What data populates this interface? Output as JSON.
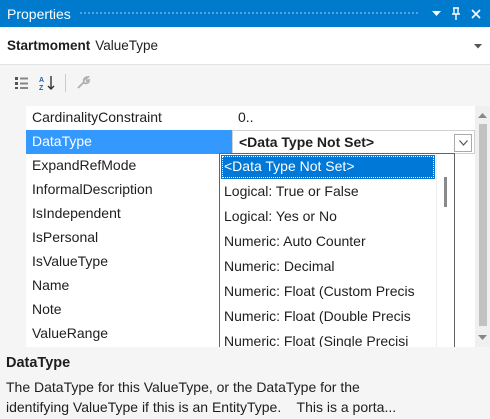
{
  "window": {
    "title": "Properties",
    "menu_icon": "chevron-down-icon",
    "pin_icon": "pin-icon",
    "close_icon": "close-icon",
    "accent": "#007acc"
  },
  "object_selector": {
    "name": "Startmoment",
    "type": "ValueType"
  },
  "toolbar": {
    "items": [
      "categorized-icon",
      "alphabetical-icon",
      "property-pages-icon"
    ]
  },
  "grid": {
    "rows": [
      {
        "name": "CardinalityConstraint",
        "value": "0.."
      },
      {
        "name": "DataType",
        "value": "<Data Type Not Set>",
        "selected": true
      },
      {
        "name": "ExpandRefMode",
        "value": ""
      },
      {
        "name": "InformalDescription",
        "value": ""
      },
      {
        "name": "IsIndependent",
        "value": ""
      },
      {
        "name": "IsPersonal",
        "value": ""
      },
      {
        "name": "IsValueType",
        "value": ""
      },
      {
        "name": "Name",
        "value": ""
      },
      {
        "name": "Note",
        "value": ""
      },
      {
        "name": "ValueRange",
        "value": ""
      }
    ],
    "selection_color": "#3399ff"
  },
  "dropdown": {
    "options": [
      "<Data Type Not Set>",
      "Logical: True or False",
      "Logical: Yes or No",
      "Numeric: Auto Counter",
      "Numeric: Decimal",
      "Numeric: Float (Custom Precis",
      "Numeric: Float (Double Precis",
      "Numeric: Float (Single Precisi"
    ],
    "selected_index": 0,
    "highlight_color": "#0078d7"
  },
  "description": {
    "title": "DataType",
    "line1": "The DataType for this ValueType, or the DataType for the",
    "line2": "identifying ValueType if this is an EntityType.    This is a porta..."
  }
}
